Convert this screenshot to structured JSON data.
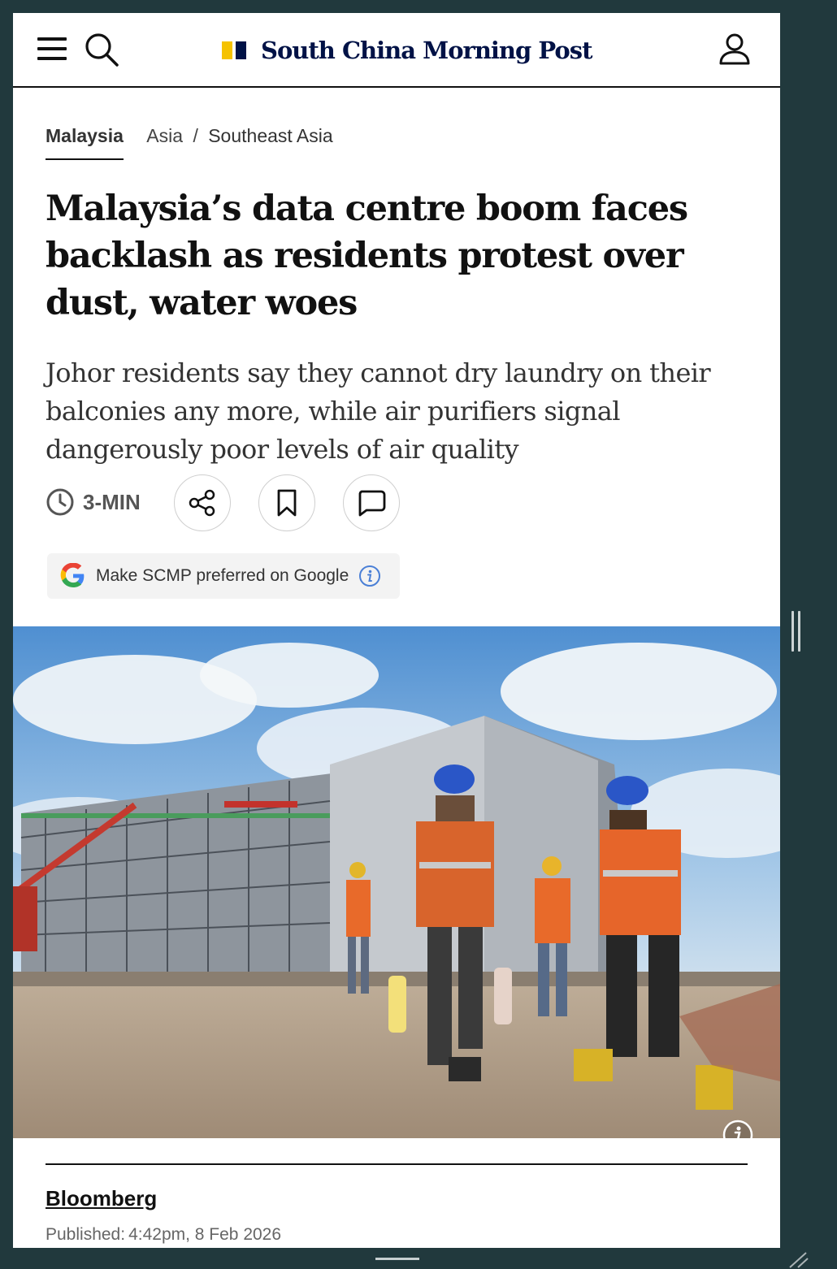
{
  "header": {
    "logo_text": "South China Morning Post",
    "brand_colors": {
      "yellow": "#f5c200",
      "navy": "#001246"
    },
    "icons": [
      "hamburger-menu-icon",
      "search-icon",
      "user-account-icon"
    ]
  },
  "breadcrumb": {
    "primary": "Malaysia",
    "secondary": "Asia",
    "separator": "/",
    "tertiary": "Southeast Asia"
  },
  "article": {
    "headline": "Malaysia’s data centre boom faces backlash as residents protest over dust, water woes",
    "subheadline": "Johor residents say they cannot dry laundry on their balconies any more, while air purifiers signal dangerously poor levels of air quality",
    "read_time": "3-MIN",
    "action_icons": [
      "share-icon",
      "bookmark-icon",
      "comment-icon"
    ],
    "google_pref_label": "Make SCMP preferred on Google",
    "hero_image_alt": "Construction workers in orange vests and blue hard hats walking toward a data centre building under construction",
    "author": "Bloomberg",
    "published_label": "Published:",
    "published_time": "4:42pm, 8 Feb 2026"
  }
}
